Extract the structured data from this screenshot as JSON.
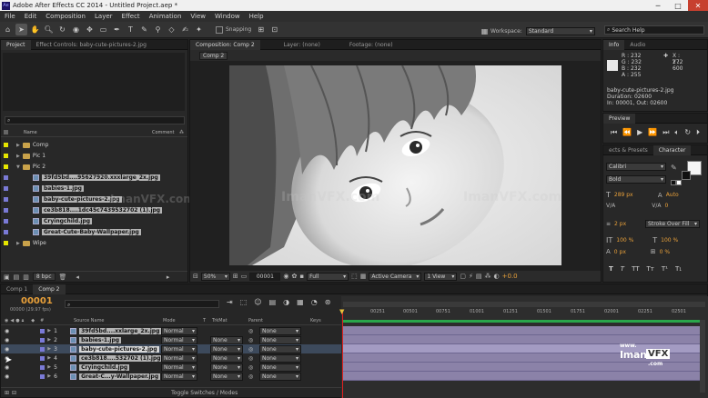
{
  "window": {
    "app_badge": "Ae",
    "title": "Adobe After Effects CC 2014 - Untitled Project.aep *",
    "min": "─",
    "max": "□",
    "close": "✕"
  },
  "menu": [
    "File",
    "Edit",
    "Composition",
    "Layer",
    "Effect",
    "Animation",
    "View",
    "Window",
    "Help"
  ],
  "toolbar": {
    "snapping": "Snapping",
    "workspace_label": "Workspace:",
    "workspace_value": "Standard",
    "search_placeholder": "Search Help"
  },
  "project_panel": {
    "tab_project": "Project",
    "tab_effects": "Effect Controls: baby-cute-pictures-2.jpg",
    "header_name": "Name",
    "header_comment": "Comment",
    "items": [
      {
        "type": "folder",
        "label": "Comp",
        "indent": 0,
        "color": "#e6e600"
      },
      {
        "type": "folder",
        "label": "Pic 1",
        "indent": 0,
        "color": "#e6e600"
      },
      {
        "type": "folder",
        "label": "Pic 2",
        "indent": 0,
        "color": "#e6e600",
        "open": true
      },
      {
        "type": "file",
        "label": "39fd5bd....95627920.xxxlarge_2x.jpg",
        "indent": 1,
        "color": "#7a7ad6"
      },
      {
        "type": "file",
        "label": "babies-1.jpg",
        "indent": 1,
        "color": "#7a7ad6"
      },
      {
        "type": "file",
        "label": "baby-cute-pictures-2.jpg",
        "indent": 1,
        "color": "#7a7ad6"
      },
      {
        "type": "file",
        "label": "ce3b818....1dc45c7439532702 (1).jpg",
        "indent": 1,
        "color": "#7a7ad6"
      },
      {
        "type": "file",
        "label": "Cryingchild.jpg",
        "indent": 1,
        "color": "#7a7ad6"
      },
      {
        "type": "file",
        "label": "Great-Cute-Baby-Wallpaper.jpg",
        "indent": 1,
        "color": "#7a7ad6"
      },
      {
        "type": "folder",
        "label": "Wipe",
        "indent": 0,
        "color": "#e6e600"
      }
    ],
    "bpc": "8 bpc"
  },
  "comp_panel": {
    "tab_comp": "Composition: Comp 2",
    "tab_layer": "Layer: (none)",
    "tab_footage": "Footage: (none)",
    "breadcrumb": "Comp 2",
    "zoom": "50%",
    "timecode": "00001",
    "resolution": "Full",
    "camera": "Active Camera",
    "view": "1 View",
    "exposure": "+0.0"
  },
  "info_panel": {
    "tab_info": "Info",
    "tab_audio": "Audio",
    "r": "R : 232",
    "g": "G : 232",
    "b": "B : 232",
    "a": "A : 255",
    "x": "X : 272",
    "y": "Y : 600",
    "file": "baby-cute-pictures-2.jpg",
    "duration": "Duration: 02600",
    "inout": "In: 00001, Out: 02600"
  },
  "preview_panel": {
    "tab": "Preview"
  },
  "character_panel": {
    "tab_effects": "ects & Presets",
    "tab_character": "Character",
    "font": "Calibri",
    "style": "Bold",
    "size": "289 px",
    "leading": "Auto",
    "tracking": "0",
    "stroke_width": "2 px",
    "stroke_type": "Stroke Over Fill",
    "vscale": "100 %",
    "hscale": "100 %",
    "baseline": "0 px",
    "tsume": "0 %"
  },
  "timeline": {
    "tab_comp1": "Comp 1",
    "tab_comp2": "Comp 2",
    "timecode": "00001",
    "fps": "00000 (29.97 fps)",
    "col_source": "Source Name",
    "col_mode": "Mode",
    "col_t": "T",
    "col_trkmat": "TrkMat",
    "col_parent": "Parent",
    "col_keys": "Keys",
    "ruler": [
      "00251",
      "00501",
      "00751",
      "01001",
      "01251",
      "01501",
      "01751",
      "02001",
      "02251",
      "02501"
    ],
    "layers": [
      {
        "num": "1",
        "name": "39fd5bd....xxlarge_2x.jpg",
        "mode": "Normal",
        "trkmat": "",
        "parent": "None"
      },
      {
        "num": "2",
        "name": "babies-1.jpg",
        "mode": "Normal",
        "trkmat": "None",
        "parent": "None"
      },
      {
        "num": "3",
        "name": "baby-cute-pictures-2.jpg",
        "mode": "Normal",
        "trkmat": "None",
        "parent": "None"
      },
      {
        "num": "4",
        "name": "ce3b818....532702 (1).jpg",
        "mode": "Normal",
        "trkmat": "None",
        "parent": "None"
      },
      {
        "num": "5",
        "name": "Cryingchild.jpg",
        "mode": "Normal",
        "trkmat": "None",
        "parent": "None"
      },
      {
        "num": "6",
        "name": "Great-C...y-Wallpaper.jpg",
        "mode": "Normal",
        "trkmat": "None",
        "parent": "None"
      }
    ],
    "toggle": "Toggle Switches / Modes"
  },
  "watermark": {
    "line1": "www.",
    "line2": "Iman",
    "line3": "VFX",
    "line4": ".com",
    "faint": "ImanVFX.com"
  }
}
